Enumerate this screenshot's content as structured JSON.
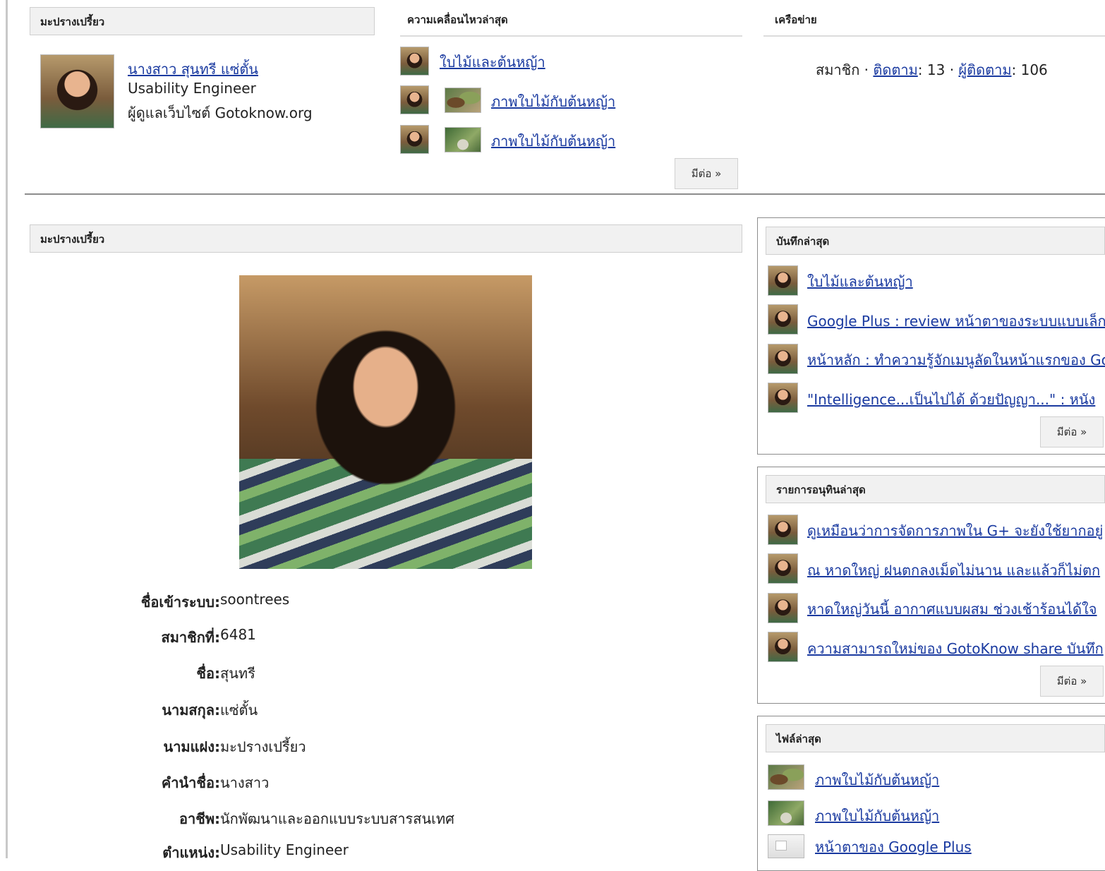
{
  "profile_header": "มะปรางเปรี้ยว",
  "profile": {
    "name": "นางสาว สุนทรี แซ่ตั้น",
    "line1": "Usability Engineer",
    "line2": "ผู้ดูแลเว็บไซต์ Gotoknow.org"
  },
  "activity": {
    "header": "ความเคลื่อนไหวล่าสุด",
    "items": [
      "ใบไม้และต้นหญ้า",
      "ภาพใบไม้กับต้นหญ้า",
      "ภาพใบไม้กับต้นหญ้า"
    ],
    "more": "มีต่อ »"
  },
  "network": {
    "header": "เครือข่าย",
    "member_label": "สมาชิก",
    "sep": "·",
    "following_label": "ติดตาม",
    "following_count": ": 13",
    "followers_label": "ผู้ติดตาม",
    "followers_count": ": 106"
  },
  "main_header": "มะปรางเปรี้ยว",
  "info": [
    {
      "label": "ชื่อเข้าระบบ:",
      "value": " soontrees"
    },
    {
      "label": "สมาชิกที่:",
      "value": " 6481"
    },
    {
      "label": "ชื่อ:",
      "value": " สุนทรี"
    },
    {
      "label": "นามสกุล:",
      "value": " แซ่ตั้น"
    },
    {
      "label": "นามแฝง:",
      "value": " มะปรางเปรี้ยว"
    },
    {
      "label": "คำนำชื่อ:",
      "value": " นางสาว"
    },
    {
      "label": "อาชีพ:",
      "value": " นักพัฒนาและออกแบบระบบสารสนเทศ"
    },
    {
      "label": "ตำแหน่ง:",
      "value": " Usability Engineer"
    }
  ],
  "latest_posts": {
    "header": "บันทึกล่าสุด",
    "items": [
      "ใบไม้และต้นหญ้า",
      "Google Plus : review หน้าตาของระบบแบบเล็ก",
      "หน้าหลัก : ทำความรู้จักเมนูลัดในหน้าแรกของ Go",
      "\"Intelligence...เป็นไปได้ ด้วยปัญญา...\" : หนัง"
    ],
    "more": "มีต่อ »"
  },
  "latest_journals": {
    "header": "รายการอนุทินล่าสุด",
    "items": [
      "ดูเหมือนว่าการจัดการภาพใน G+ จะยังใช้ยากอยู่",
      "ณ หาดใหญ่ ฝนตกลงเม็ดไม่นาน และแล้วก็ไม่ตก",
      "หาดใหญ่วันนี้ อากาศแบบผสม ช่วงเช้าร้อนได้ใจ",
      "ความสามารถใหม่ของ GotoKnow share บันทึก"
    ],
    "more": "มีต่อ »"
  },
  "latest_files": {
    "header": "ไฟล์ล่าสุด",
    "items": [
      "ภาพใบไม้กับต้นหญ้า",
      "ภาพใบไม้กับต้นหญ้า",
      "หน้าตาของ Google Plus"
    ]
  }
}
